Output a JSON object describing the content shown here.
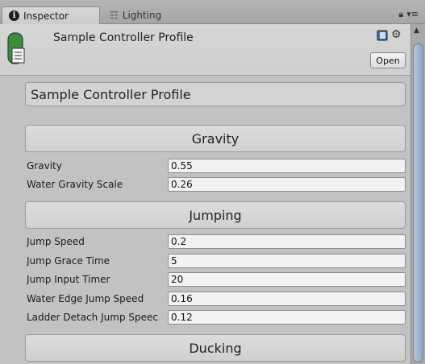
{
  "tabs": [
    {
      "label": "Inspector",
      "icon": "info-icon"
    },
    {
      "label": "Lighting",
      "icon": "lighting-icon"
    }
  ],
  "header": {
    "asset_name": "Sample Controller Profile",
    "open_label": "Open"
  },
  "profile_box_title": "Sample Controller Profile",
  "sections": [
    {
      "title": "Gravity",
      "fields": [
        {
          "label": "Gravity",
          "value": "0.55"
        },
        {
          "label": "Water Gravity Scale",
          "value": "0.26"
        }
      ]
    },
    {
      "title": "Jumping",
      "fields": [
        {
          "label": "Jump Speed",
          "value": "0.2"
        },
        {
          "label": "Jump Grace Time",
          "value": "5"
        },
        {
          "label": "Jump Input Timer",
          "value": "20"
        },
        {
          "label": "Water Edge Jump Speed",
          "value": "0.16"
        },
        {
          "label": "Ladder Detach Jump Speec",
          "value": "0.12"
        }
      ]
    },
    {
      "title": "Ducking",
      "fields": []
    }
  ],
  "colors": {
    "panel": "#c2c2c2",
    "field": "#f2f2f2",
    "asset_icon": "#3f8a3f",
    "scroll_thumb": "#8ea6c4"
  }
}
